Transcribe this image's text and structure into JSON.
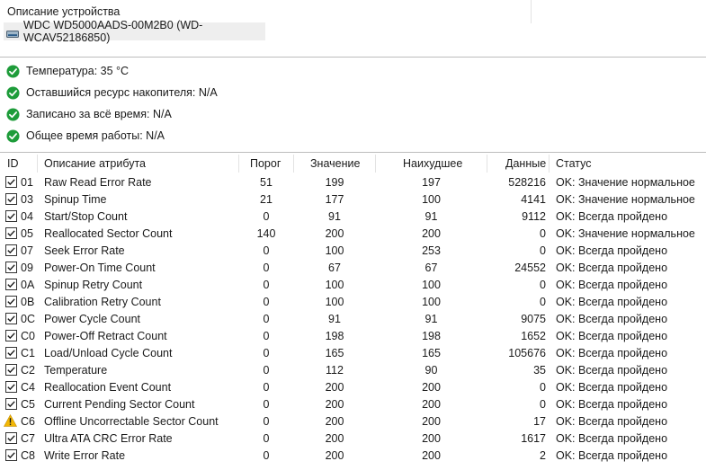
{
  "header": {
    "title": "Описание устройства",
    "device_name": "WDC WD5000AADS-00M2B0 (WD-WCAV52186850)"
  },
  "summary": [
    {
      "label": "Температура: 35 °C"
    },
    {
      "label": "Оставшийся ресурс накопителя: N/A"
    },
    {
      "label": "Записано за всё время: N/A"
    },
    {
      "label": "Общее время работы: N/A"
    }
  ],
  "columns": {
    "id": "ID",
    "name": "Описание атрибута",
    "threshold": "Порог",
    "value": "Значение",
    "worst": "Наихудшее",
    "data": "Данные",
    "status": "Статус"
  },
  "attributes": [
    {
      "id": "01",
      "name": "Raw Read Error Rate",
      "threshold": "51",
      "value": "199",
      "worst": "197",
      "data": "528216",
      "status": "OK: Значение нормальное",
      "icon": "checkbox"
    },
    {
      "id": "03",
      "name": "Spinup Time",
      "threshold": "21",
      "value": "177",
      "worst": "100",
      "data": "4141",
      "status": "OK: Значение нормальное",
      "icon": "checkbox"
    },
    {
      "id": "04",
      "name": "Start/Stop Count",
      "threshold": "0",
      "value": "91",
      "worst": "91",
      "data": "9112",
      "status": "OK: Всегда пройдено",
      "icon": "checkbox"
    },
    {
      "id": "05",
      "name": "Reallocated Sector Count",
      "threshold": "140",
      "value": "200",
      "worst": "200",
      "data": "0",
      "status": "OK: Значение нормальное",
      "icon": "checkbox"
    },
    {
      "id": "07",
      "name": "Seek Error Rate",
      "threshold": "0",
      "value": "100",
      "worst": "253",
      "data": "0",
      "status": "OK: Всегда пройдено",
      "icon": "checkbox"
    },
    {
      "id": "09",
      "name": "Power-On Time Count",
      "threshold": "0",
      "value": "67",
      "worst": "67",
      "data": "24552",
      "status": "OK: Всегда пройдено",
      "icon": "checkbox"
    },
    {
      "id": "0A",
      "name": "Spinup Retry Count",
      "threshold": "0",
      "value": "100",
      "worst": "100",
      "data": "0",
      "status": "OK: Всегда пройдено",
      "icon": "checkbox"
    },
    {
      "id": "0B",
      "name": "Calibration Retry Count",
      "threshold": "0",
      "value": "100",
      "worst": "100",
      "data": "0",
      "status": "OK: Всегда пройдено",
      "icon": "checkbox"
    },
    {
      "id": "0C",
      "name": "Power Cycle Count",
      "threshold": "0",
      "value": "91",
      "worst": "91",
      "data": "9075",
      "status": "OK: Всегда пройдено",
      "icon": "checkbox"
    },
    {
      "id": "C0",
      "name": "Power-Off Retract Count",
      "threshold": "0",
      "value": "198",
      "worst": "198",
      "data": "1652",
      "status": "OK: Всегда пройдено",
      "icon": "checkbox"
    },
    {
      "id": "C1",
      "name": "Load/Unload Cycle Count",
      "threshold": "0",
      "value": "165",
      "worst": "165",
      "data": "105676",
      "status": "OK: Всегда пройдено",
      "icon": "checkbox"
    },
    {
      "id": "C2",
      "name": "Temperature",
      "threshold": "0",
      "value": "112",
      "worst": "90",
      "data": "35",
      "status": "OK: Всегда пройдено",
      "icon": "checkbox"
    },
    {
      "id": "C4",
      "name": "Reallocation Event Count",
      "threshold": "0",
      "value": "200",
      "worst": "200",
      "data": "0",
      "status": "OK: Всегда пройдено",
      "icon": "checkbox"
    },
    {
      "id": "C5",
      "name": "Current Pending Sector Count",
      "threshold": "0",
      "value": "200",
      "worst": "200",
      "data": "0",
      "status": "OK: Всегда пройдено",
      "icon": "checkbox"
    },
    {
      "id": "C6",
      "name": "Offline Uncorrectable Sector Count",
      "threshold": "0",
      "value": "200",
      "worst": "200",
      "data": "17",
      "status": "OK: Всегда пройдено",
      "icon": "warning"
    },
    {
      "id": "C7",
      "name": "Ultra ATA CRC Error Rate",
      "threshold": "0",
      "value": "200",
      "worst": "200",
      "data": "1617",
      "status": "OK: Всегда пройдено",
      "icon": "checkbox"
    },
    {
      "id": "C8",
      "name": "Write Error Rate",
      "threshold": "0",
      "value": "200",
      "worst": "200",
      "data": "2",
      "status": "OK: Всегда пройдено",
      "icon": "checkbox"
    }
  ],
  "colors": {
    "ok_green": "#1e9c3a",
    "warning_yellow": "#f2b705",
    "device_row_bg": "#eeeeee",
    "checkbox_border": "#333333"
  }
}
